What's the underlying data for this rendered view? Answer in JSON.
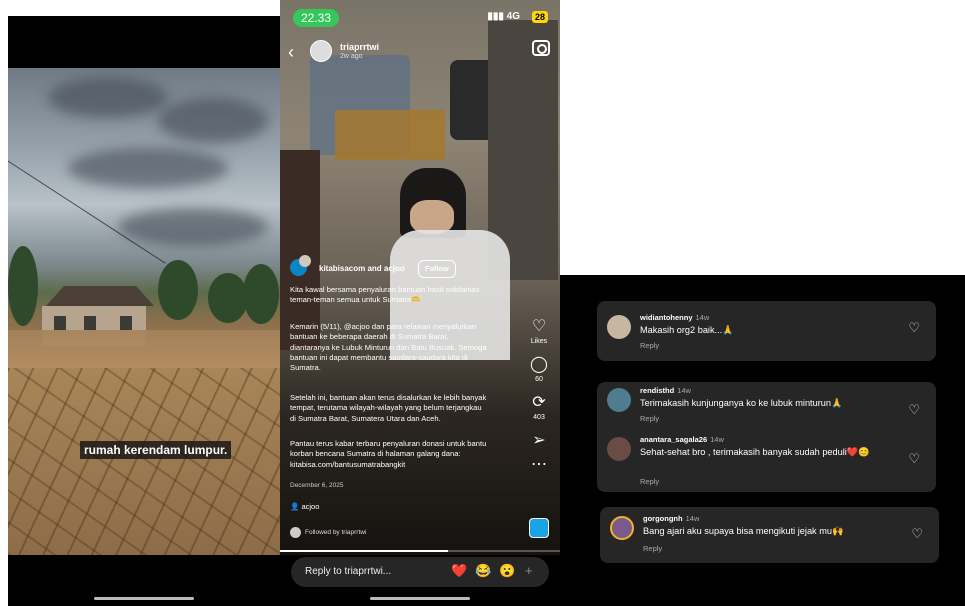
{
  "left_video": {
    "subtitle": "rumah kerendam lumpur."
  },
  "post": {
    "status": {
      "time": "22.33",
      "network": "4G",
      "battery": "28"
    },
    "header": {
      "username": "triaprrtwi",
      "time_ago": "2w ago"
    },
    "coauthors": "kitabisacom and acjoo",
    "follow_label": "Follow",
    "caption_p1": "Kita kawal bersama penyaluran bantuan hasil solidaritas\nteman-teman semua untuk Sumatra🫶",
    "caption_p2": "Kemarin (5/11), @acjoo dan para relawan menyalurkan\nbantuan ke beberapa daerah di Sumatra Barat,\ndiantaranya ke Lubuk Minturun dan Batu Busuak. Semoga\nbantuan ini dapat membantu saudara-saudara kita di\nSumatra.",
    "caption_p3": "Setelah ini, bantuan akan terus disalurkan ke lebih banyak\ntempat, terutama wilayah-wilayah yang belum terjangkau\ndi Sumatra Barat, Sumatera Utara dan Aceh.",
    "caption_p4": "Pantau terus kabar terbaru penyaluran donasi untuk bantu\nkorban bencana Sumatra di halaman galang dana:\nkitabisa.com/bantusumatrabangkit",
    "date": "December 6, 2025",
    "collaborator": "acjoo",
    "followed_by": "Followed by triaprrtwi",
    "actions": {
      "likes_label": "Likes",
      "comments": "60",
      "reposts": "403"
    },
    "progress": 0.6,
    "reply_placeholder": "Reply to triaprrtwi...",
    "quick_reactions": [
      "❤️",
      "😂",
      "😮",
      "+"
    ]
  },
  "comments_panel": {
    "cards": [
      {
        "comments": [
          {
            "user": "widiantohenny",
            "age": "14w",
            "text": "Makasih org2 baik...🙏",
            "reply": "Reply"
          }
        ]
      },
      {
        "comments": [
          {
            "user": "rendisthd",
            "age": "14w",
            "text": "Terimakasih kunjunganya ko ke lubuk minturun🙏",
            "reply": "Reply"
          },
          {
            "user": "anantara_sagala26",
            "age": "14w",
            "text": "Sehat-sehat bro , terimakasih banyak sudah peduli❤️😊",
            "reply": "Reply"
          }
        ]
      },
      {
        "comments": [
          {
            "user": "gorgongnh",
            "age": "14w",
            "text": "Bang ajari aku supaya bisa mengikuti jejak mu🙌",
            "reply": "Reply"
          }
        ]
      }
    ]
  }
}
